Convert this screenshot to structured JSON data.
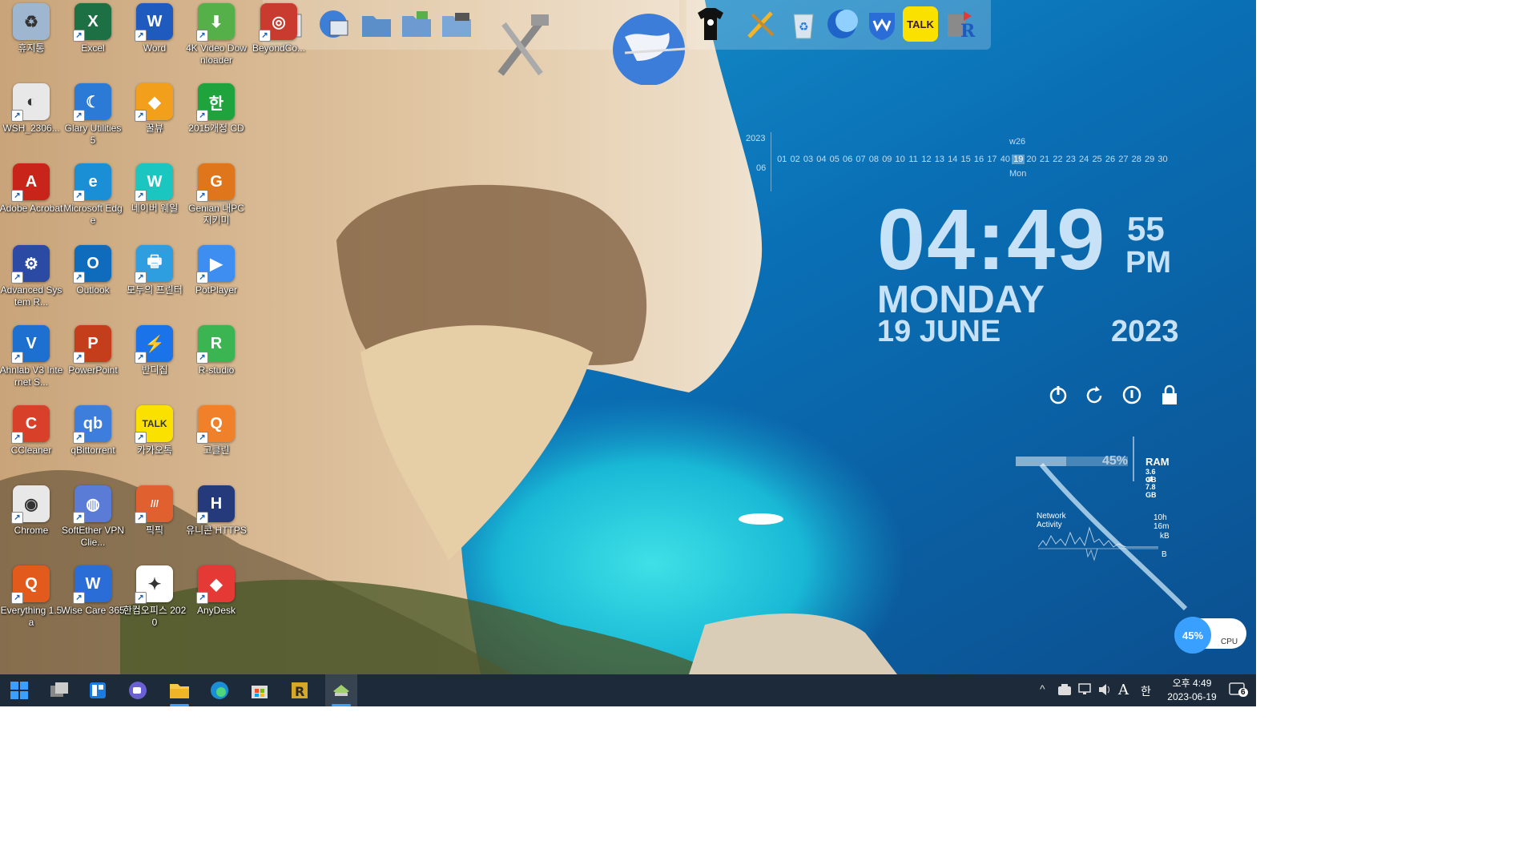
{
  "desktop_icons": [
    {
      "label": "휴지통",
      "color": "#9fb6d0",
      "glyph": "♻"
    },
    {
      "label": "Excel",
      "color": "#1d7044",
      "glyph": "X"
    },
    {
      "label": "Word",
      "color": "#1f5bbf",
      "glyph": "W"
    },
    {
      "label": "4K Video Downloader",
      "color": "#55b04a",
      "glyph": "⬇"
    },
    {
      "label": "BeyondCo...",
      "color": "#c93b2e",
      "glyph": "◎"
    },
    {
      "label": "WSH_2306...",
      "color": "#e8e8e8",
      "glyph": "◐"
    },
    {
      "label": "Glary Utilities 5",
      "color": "#2a7ad6",
      "glyph": "☾"
    },
    {
      "label": "꿀뷰",
      "color": "#f2a01c",
      "glyph": "◆"
    },
    {
      "label": "2015개정 CD",
      "color": "#1ea33d",
      "glyph": "한"
    },
    {
      "label": "Adobe Acrobat",
      "color": "#c8241a",
      "glyph": "A"
    },
    {
      "label": "Microsoft Edge",
      "color": "#1b8fd6",
      "glyph": "e"
    },
    {
      "label": "네이버 웨일",
      "color": "#1cc6c0",
      "glyph": "W"
    },
    {
      "label": "Genian 내PC지키미",
      "color": "#e0761c",
      "glyph": "G"
    },
    {
      "label": "Advanced System R...",
      "color": "#2b4aa3",
      "glyph": "⚙"
    },
    {
      "label": "Outlook",
      "color": "#0f6cbd",
      "glyph": "O"
    },
    {
      "label": "모두의 프린터",
      "color": "#2e9ee0",
      "glyph": "🖶"
    },
    {
      "label": "PotPlayer",
      "color": "#3d8ef0",
      "glyph": "▶"
    },
    {
      "label": "Ahnlab V3 Internet S...",
      "color": "#1d6fd0",
      "glyph": "V"
    },
    {
      "label": "PowerPoint",
      "color": "#c43e1c",
      "glyph": "P"
    },
    {
      "label": "반디집",
      "color": "#1a73e8",
      "glyph": "⚡"
    },
    {
      "label": "R-studio",
      "color": "#3bb552",
      "glyph": "R"
    },
    {
      "label": "CCleaner",
      "color": "#d8402a",
      "glyph": "C"
    },
    {
      "label": "qBittorrent",
      "color": "#3d7ddb",
      "glyph": "qb"
    },
    {
      "label": "카카오톡",
      "color": "#fae100",
      "glyph": "TALK"
    },
    {
      "label": "고클린",
      "color": "#f0802a",
      "glyph": "Q"
    },
    {
      "label": "Chrome",
      "color": "#e8e8e8",
      "glyph": "◉"
    },
    {
      "label": "SoftEther VPN Clie...",
      "color": "#5a7bd6",
      "glyph": "◍"
    },
    {
      "label": "픽픽",
      "color": "#e06030",
      "glyph": "///"
    },
    {
      "label": "유니콘 HTTPS",
      "color": "#243a7a",
      "glyph": "H"
    },
    {
      "label": "Everything 1.5a",
      "color": "#e25a1c",
      "glyph": "Q"
    },
    {
      "label": "Wise Care 365",
      "color": "#2b6dd6",
      "glyph": "W"
    },
    {
      "label": "한컴오피스 2020",
      "color": "#ffffff",
      "glyph": "✦"
    },
    {
      "label": "AnyDesk",
      "color": "#e53935",
      "glyph": "◆"
    }
  ],
  "calendar": {
    "year": "2023",
    "month": "06",
    "week": "w26",
    "selected_day": "19",
    "weekday": "Mon",
    "days": [
      "01",
      "02",
      "03",
      "04",
      "05",
      "06",
      "07",
      "08",
      "09",
      "10",
      "11",
      "12",
      "13",
      "14",
      "15",
      "16",
      "17",
      "40",
      "19",
      "20",
      "21",
      "22",
      "23",
      "24",
      "25",
      "26",
      "27",
      "28",
      "29",
      "30"
    ]
  },
  "clock": {
    "hours": "04",
    "minutes": "49",
    "separator": ":",
    "seconds": "55",
    "ampm": "PM",
    "day": "MONDAY",
    "date": "19 JUNE",
    "year": "2023"
  },
  "system_monitor": {
    "ram_percent": "45%",
    "ram_label": "RAM",
    "ram_used": "3.6 GB",
    "ram_total": "of 7.8 GB",
    "network_label": "Network Activity",
    "net_uptime": "10h 16m",
    "net_rate1": "kB",
    "net_rate2": "B",
    "cpu_percent": "45%",
    "cpu_label": "CPU"
  },
  "taskbar": {
    "clock_time": "오후 4:49",
    "clock_date": "2023-06-19",
    "ime_lang": "A",
    "ime_mode": "한",
    "notif_count": "6"
  },
  "colors": {
    "taskbar": "#1c2a3a",
    "accent": "#3aa0ff"
  }
}
